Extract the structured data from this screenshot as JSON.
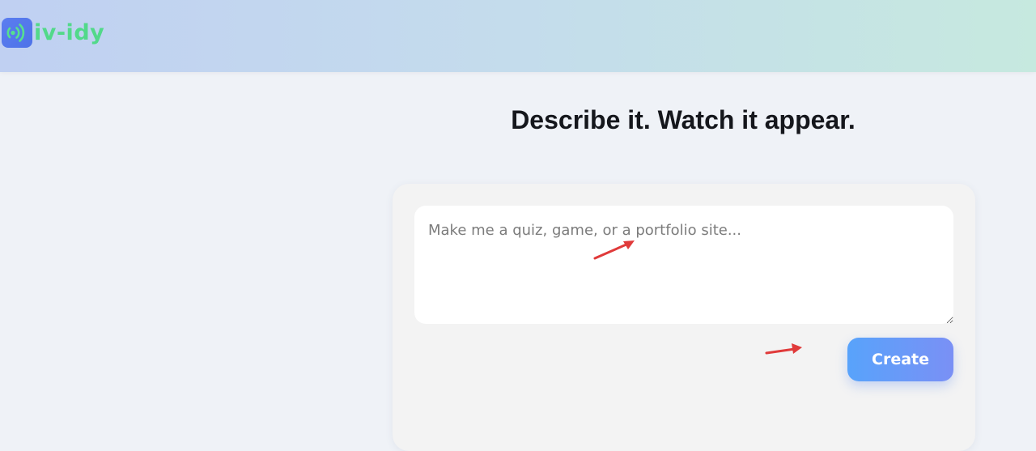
{
  "header": {
    "logo_text": "iv-idy",
    "logo_icon": "broadcast-icon"
  },
  "main": {
    "headline": "Describe it. Watch it appear.",
    "prompt_placeholder": "Make me a quiz, game, or a portfolio site...",
    "prompt_value": "",
    "create_label": "Create"
  },
  "annotations": {
    "arrow_color": "#e03a3a"
  },
  "colors": {
    "logo_green": "#52d98a",
    "logo_blue": "#5b7df0",
    "button_start": "#58a3fb",
    "button_end": "#7a90f5"
  }
}
